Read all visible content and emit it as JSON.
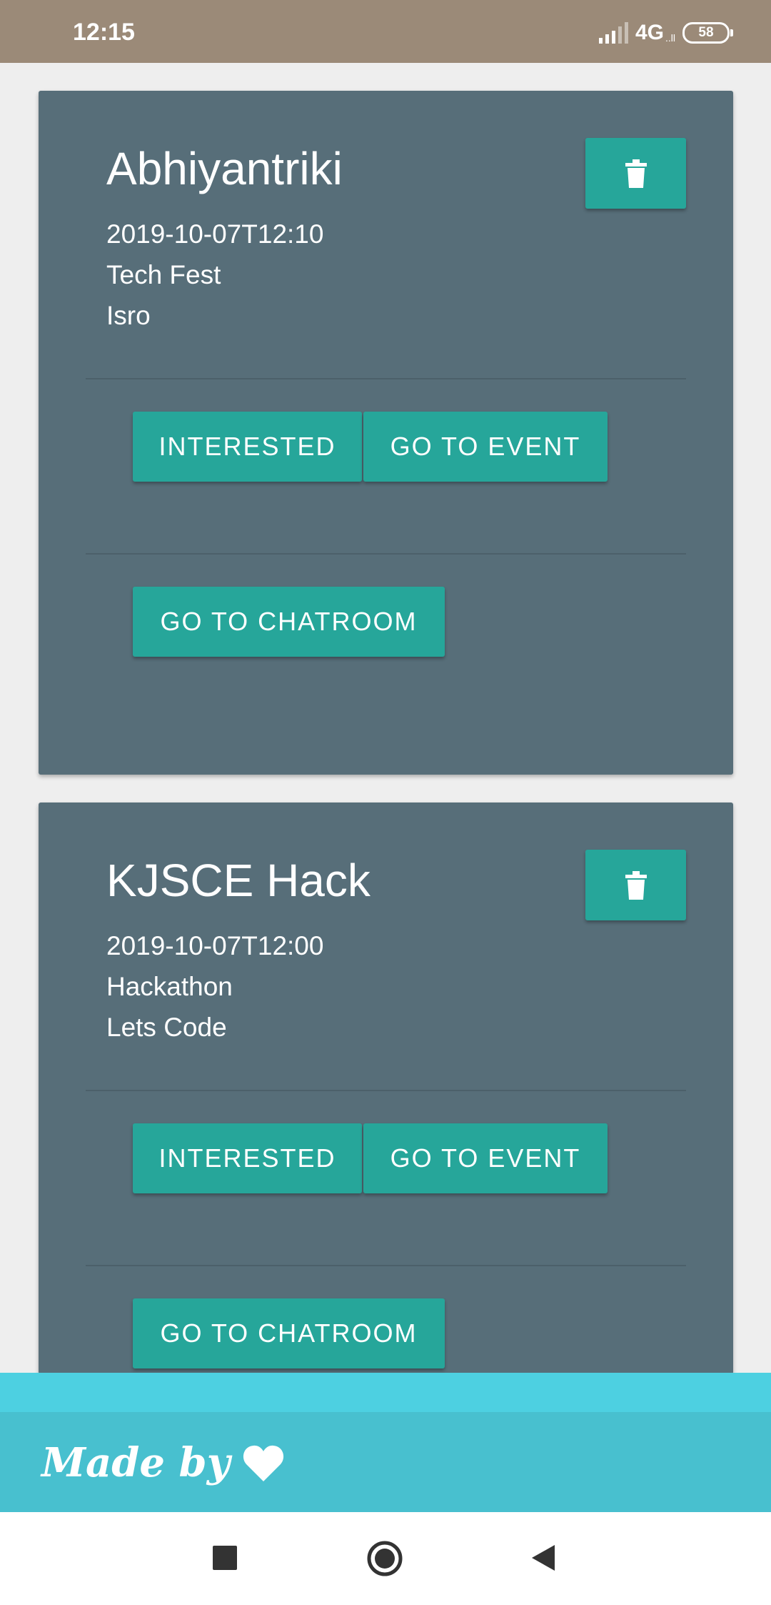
{
  "status_bar": {
    "time": "12:15",
    "network": "4G",
    "network_sub": "..ll",
    "battery": "58"
  },
  "events": [
    {
      "title": "Abhiyantriki",
      "datetime": "2019-10-07T12:10",
      "type": "Tech Fest",
      "organizer": "Isro",
      "interested_label": "INTERESTED",
      "go_to_event_label": "GO TO EVENT",
      "go_to_chatroom_label": "GO TO CHATROOM",
      "delete_icon": "trash-icon"
    },
    {
      "title": "KJSCE Hack",
      "datetime": "2019-10-07T12:00",
      "type": "Hackathon",
      "organizer": "Lets Code",
      "interested_label": "INTERESTED",
      "go_to_event_label": "GO TO EVENT",
      "go_to_chatroom_label": "GO TO CHATROOM",
      "delete_icon": "trash-icon"
    }
  ],
  "footer": {
    "made_by": "Made by",
    "heart_icon": "heart-icon"
  },
  "nav": {
    "recents_icon": "square-icon",
    "home_icon": "circle-icon",
    "back_icon": "triangle-back-icon"
  },
  "colors": {
    "card": "#576e79",
    "accent": "#26a69a",
    "footer": "#48c0cf",
    "status_bar": "#9b8a78"
  }
}
